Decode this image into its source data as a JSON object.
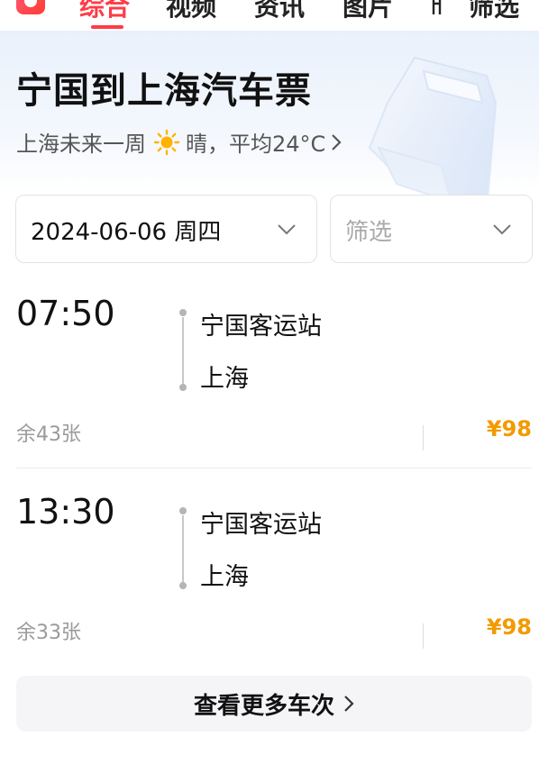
{
  "tabs": [
    {
      "label": "综合",
      "active": true
    },
    {
      "label": "视频"
    },
    {
      "label": "资讯"
    },
    {
      "label": "图片"
    },
    {
      "label": "筛选"
    }
  ],
  "header": {
    "title": "宁国到上海汽车票",
    "weather_prefix": "上海未来一周",
    "weather_icon": "sun-icon",
    "weather_text": "晴，平均24°C"
  },
  "filters": {
    "date_value": "2024-06-06 周四",
    "filter_placeholder": "筛选"
  },
  "trips": [
    {
      "time": "07:50",
      "from": "宁国客运站",
      "to": "上海",
      "remaining": "余43张",
      "price": "¥98"
    },
    {
      "time": "13:30",
      "from": "宁国客运站",
      "to": "上海",
      "remaining": "余33张",
      "price": "¥98"
    }
  ],
  "more_button": "查看更多车次",
  "colors": {
    "accent": "#ff3b46",
    "price": "#f39a00"
  }
}
